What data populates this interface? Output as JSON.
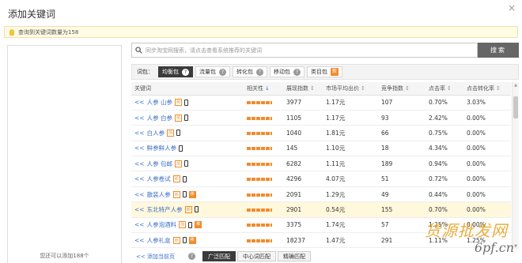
{
  "dialog": {
    "title": "添加关键词",
    "close_symbol": "×"
  },
  "notice": {
    "text": "查询到关键词数量为158"
  },
  "left_panel": {
    "hint": "您还可以添加188个"
  },
  "search": {
    "placeholder": "同步淘宝网搜索，请点击查看系统推荐的关键词",
    "button_label": "搜索"
  },
  "packages": {
    "label": "词包：",
    "items": [
      {
        "label": "均衡包",
        "active": true,
        "badge": "?"
      },
      {
        "label": "流量包",
        "active": false,
        "badge": "?"
      },
      {
        "label": "转化包",
        "active": false,
        "badge": "?"
      },
      {
        "label": "移动包",
        "active": false,
        "badge": "?"
      },
      {
        "label": "类目包",
        "active": false,
        "badge": "新"
      }
    ]
  },
  "table": {
    "headers": [
      "关键词",
      "相关性",
      "展现指数",
      "市场平均出价",
      "竞争指数",
      "点击率",
      "点击转化率"
    ],
    "header_arrows": [
      "",
      "↓",
      "↕",
      "↕",
      "↕",
      "↕",
      "↕"
    ],
    "rows": [
      {
        "prefix": "<<",
        "keyword": "人参 山参",
        "o_icon": true,
        "phone": true,
        "mobile_badge": false,
        "impressions": "3977",
        "avg_bid": "1.17元",
        "competition": "107",
        "ctr": "0.70%",
        "cvr": "3.03%",
        "highlight": false
      },
      {
        "prefix": "<<",
        "keyword": "人参 白参",
        "o_icon": true,
        "phone": true,
        "mobile_badge": false,
        "impressions": "1105",
        "avg_bid": "1.17元",
        "competition": "93",
        "ctr": "2.42%",
        "cvr": "0.00%",
        "highlight": false
      },
      {
        "prefix": "<<",
        "keyword": "白人参",
        "o_icon": true,
        "phone": true,
        "mobile_badge": false,
        "impressions": "1040",
        "avg_bid": "1.81元",
        "competition": "66",
        "ctr": "0.75%",
        "cvr": "0.00%",
        "highlight": false
      },
      {
        "prefix": "<<",
        "keyword": "鲜参鲜人参",
        "o_icon": false,
        "phone": true,
        "mobile_badge": false,
        "impressions": "145",
        "avg_bid": "1.10元",
        "competition": "18",
        "ctr": "4.34%",
        "cvr": "0.00%",
        "highlight": false
      },
      {
        "prefix": "<<",
        "keyword": "人参 包邮",
        "o_icon": true,
        "phone": true,
        "mobile_badge": false,
        "impressions": "6282",
        "avg_bid": "1.11元",
        "competition": "189",
        "ctr": "0.94%",
        "cvr": "0.00%",
        "highlight": false
      },
      {
        "prefix": "<<",
        "keyword": "人参卷试",
        "o_icon": true,
        "phone": true,
        "mobile_badge": false,
        "impressions": "4296",
        "avg_bid": "4.07元",
        "competition": "51",
        "ctr": "0.72%",
        "cvr": "0.00%",
        "highlight": false
      },
      {
        "prefix": "<<",
        "keyword": "散装人参",
        "o_icon": true,
        "phone": true,
        "mobile_badge": true,
        "impressions": "2091",
        "avg_bid": "1.29元",
        "competition": "49",
        "ctr": "0.44%",
        "cvr": "0.00%",
        "highlight": false
      },
      {
        "prefix": "<<",
        "keyword": "东北特产人参",
        "o_icon": true,
        "phone": true,
        "mobile_badge": false,
        "impressions": "2901",
        "avg_bid": "0.54元",
        "competition": "155",
        "ctr": "0.70%",
        "cvr": "0.00%",
        "highlight": true
      },
      {
        "prefix": "<<",
        "keyword": "人参泡酒料",
        "o_icon": true,
        "phone": true,
        "mobile_badge": true,
        "impressions": "3375",
        "avg_bid": "1.74元",
        "competition": "57",
        "ctr": "1.25%",
        "cvr": "0.00%",
        "highlight": false
      },
      {
        "prefix": "<<",
        "keyword": "人参礼盒",
        "o_icon": true,
        "phone": true,
        "mobile_badge": true,
        "impressions": "18237",
        "avg_bid": "1.47元",
        "competition": "291",
        "ctr": "1.11%",
        "cvr": "1.25%",
        "highlight": false
      }
    ]
  },
  "bottom": {
    "add_page_label": "<<  添加当前页",
    "help_symbol": "?",
    "match_buttons": [
      {
        "label": "广泛匹配",
        "active": true
      },
      {
        "label": "中心词匹配",
        "active": false
      },
      {
        "label": "精确匹配",
        "active": false
      }
    ]
  },
  "watermark": {
    "text": "货源批发网",
    "url": "6pf.cn"
  },
  "colors": {
    "link": "#3a6fc4",
    "accent": "#f28b2c",
    "highlight_row": "#fff8dc",
    "active_button": "#3b3b3b"
  }
}
